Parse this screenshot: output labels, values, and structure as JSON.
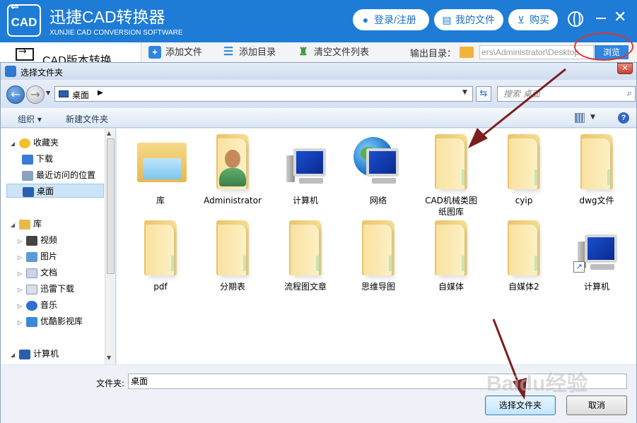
{
  "app": {
    "logo_text": "CAD",
    "title": "迅捷CAD转换器",
    "subtitle": "XUNJIE CAD CONVERSION SOFTWARE",
    "buttons": {
      "login": "登录/注册",
      "my_files": "我的文件",
      "buy": "购买"
    },
    "accent_color": "#1e7cd6"
  },
  "toolbar": {
    "side_tab": "CAD版本转换",
    "add_file": "添加文件",
    "add_dir": "添加目录",
    "clear_list": "清空文件列表",
    "output_label": "输出目录：",
    "output_path": "ers\\Administrator\\Desktop",
    "browse": "浏览"
  },
  "dialog": {
    "title": "选择文件夹",
    "address": "桌面",
    "search_placeholder": "搜索 桌面",
    "commands": {
      "organize": "组织 ▾",
      "new_folder": "新建文件夹"
    },
    "nav": {
      "favorites": "收藏夹",
      "downloads": "下载",
      "recent": "最近访问的位置",
      "desktop": "桌面",
      "libraries": "库",
      "videos": "视频",
      "pictures": "图片",
      "documents": "文档",
      "xunlei": "迅雷下载",
      "music": "音乐",
      "youku": "优酷影视库",
      "computer": "计算机"
    },
    "items": [
      {
        "name": "库",
        "icon": "library-icon"
      },
      {
        "name": "Administrator",
        "icon": "user-icon"
      },
      {
        "name": "计算机",
        "icon": "computer-icon"
      },
      {
        "name": "网络",
        "icon": "network-icon"
      },
      {
        "name": "CAD机械类图纸图库",
        "icon": "folder-icon"
      },
      {
        "name": "cyip",
        "icon": "folder-icon"
      },
      {
        "name": "dwg文件",
        "icon": "folder-icon"
      },
      {
        "name": "pdf",
        "icon": "folder-icon"
      },
      {
        "name": "分期表",
        "icon": "folder-icon"
      },
      {
        "name": "流程图文章",
        "icon": "folder-icon"
      },
      {
        "name": "思维导图",
        "icon": "folder-icon"
      },
      {
        "name": "自媒体",
        "icon": "folder-icon"
      },
      {
        "name": "自媒体2",
        "icon": "folder-icon"
      },
      {
        "name": "计算机",
        "icon": "computer-shortcut-icon"
      }
    ],
    "folder_label": "文件夹:",
    "folder_value": "桌面",
    "select_button": "选择文件夹",
    "cancel_button": "取消"
  },
  "watermark": "Baidu经验"
}
